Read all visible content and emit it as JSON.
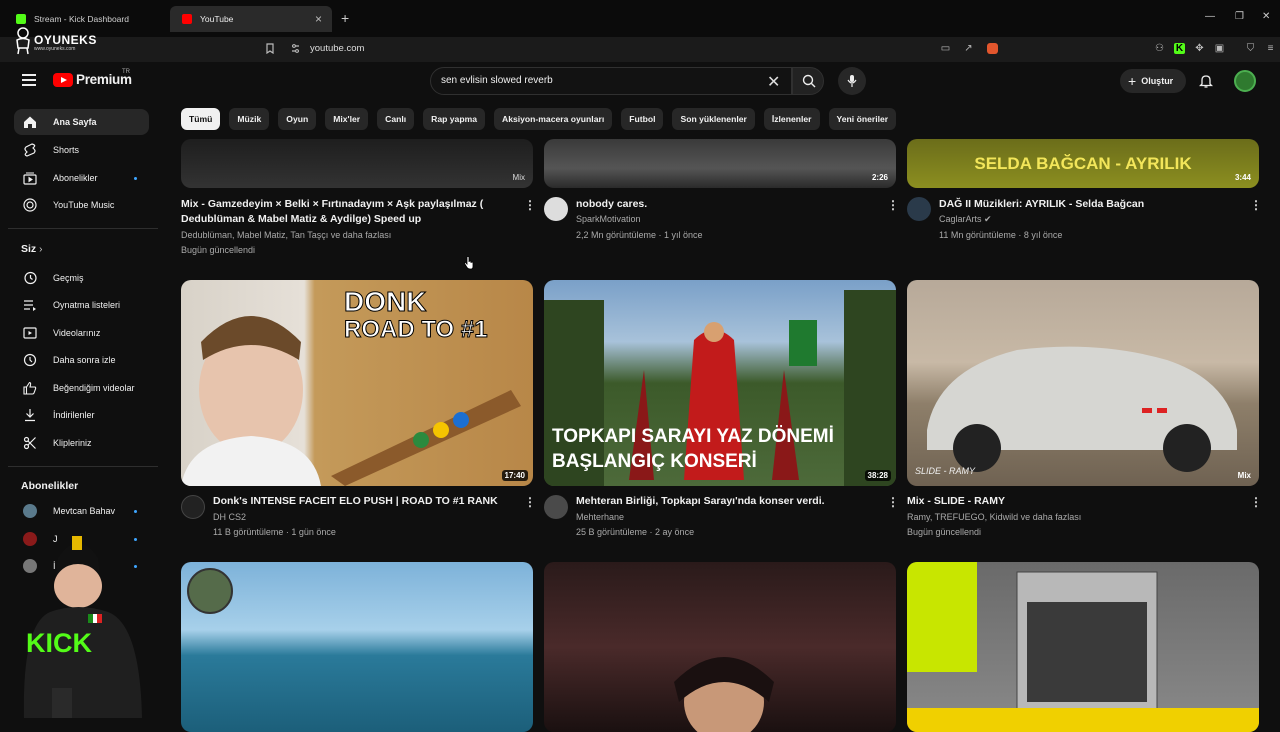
{
  "browser": {
    "tabs": [
      {
        "title": "Stream - Kick Dashboard"
      },
      {
        "title": "YouTube"
      }
    ],
    "url": "youtube.com",
    "overlay_logo": {
      "name": "OYUNEKS",
      "sub": "www.oyuneks.com"
    }
  },
  "header": {
    "logo_text": "Premium",
    "logo_region": "TR",
    "search_query": "sen evlisin slowed reverb",
    "create_label": "Oluştur"
  },
  "chips": [
    "Tümü",
    "Müzik",
    "Oyun",
    "Mix'ler",
    "Canlı",
    "Rap yapma",
    "Aksiyon-macera oyunları",
    "Futbol",
    "Son yüklenenler",
    "İzlenenler",
    "Yeni öneriler"
  ],
  "sidebar": {
    "main": [
      {
        "label": "Ana Sayfa",
        "icon": "home-icon"
      },
      {
        "label": "Shorts",
        "icon": "shorts-icon"
      },
      {
        "label": "Abonelikler",
        "icon": "subscriptions-icon"
      },
      {
        "label": "YouTube Music",
        "icon": "youtube-music-icon"
      }
    ],
    "you_header": "Siz",
    "you": [
      {
        "label": "Geçmiş",
        "icon": "history-icon"
      },
      {
        "label": "Oynatma listeleri",
        "icon": "playlists-icon"
      },
      {
        "label": "Videolarınız",
        "icon": "your-videos-icon"
      },
      {
        "label": "Daha sonra izle",
        "icon": "watch-later-icon"
      },
      {
        "label": "Beğendiğim videolar",
        "icon": "liked-videos-icon"
      },
      {
        "label": "İndirilenler",
        "icon": "downloads-icon"
      },
      {
        "label": "Klipleriniz",
        "icon": "clips-icon"
      }
    ],
    "subs_header": "Abonelikler",
    "subscriptions": [
      {
        "label": "Mevtcan Bahav",
        "color": "#5a7a8c"
      },
      {
        "label": "J",
        "color": "#8a1a1a"
      },
      {
        "label": "İ",
        "color": "#777777"
      }
    ]
  },
  "videos": [
    {
      "title": "Mix - Gamzedeyim × Belki × Fırtınadayım × Aşk paylaşılmaz ( Dedublüman & Mabel Matiz & Aydilge) Speed up",
      "channel": "Dedublüman, Mabel Matiz, Tan Taşçı ve daha fazlası",
      "meta": "Bugün güncellendi",
      "badge": "Mix",
      "channel_avatar": false
    },
    {
      "title": "nobody cares.",
      "channel": "SparkMotivation",
      "meta": "2,2 Mn görüntüleme · 1 yıl önce",
      "duration": "2:26"
    },
    {
      "title": "DAĞ II Müzikleri: AYRILIK - Selda Bağcan",
      "channel": "CaglarArts",
      "meta": "11 Mn görüntüleme · 8 yıl önce",
      "duration": "3:44",
      "thumb_text": "SELDA BAĞCAN - AYRILIK"
    },
    {
      "title": "Donk's INTENSE FACEIT ELO PUSH | ROAD TO #1 RANK",
      "channel": "DH CS2",
      "meta": "11 B görüntüleme · 1 gün önce",
      "duration": "17:40",
      "thumb_text": [
        "DONK",
        "ROAD TO #1"
      ]
    },
    {
      "title": "Mehteran Birliği, Topkapı Sarayı'nda konser verdi.",
      "channel": "Mehterhane",
      "meta": "25 B görüntüleme · 2 ay önce",
      "duration": "38:28",
      "thumb_text": [
        "TOPKAPI SARAYI YAZ DÖNEMİ",
        "BAŞLANGIÇ KONSERİ"
      ]
    },
    {
      "title": "Mix - SLIDE - RAMY",
      "channel": "Ramy, TREFUEGO, Kidwild ve daha fazlası",
      "meta": "Bugün güncellendi",
      "badge": "Mix",
      "thumb_text": "SLIDE - RAMY"
    }
  ],
  "colors": {
    "bg": "#0f0f0f",
    "chip": "#272727",
    "accent": "#ff0000",
    "kick": "#53fc18"
  }
}
